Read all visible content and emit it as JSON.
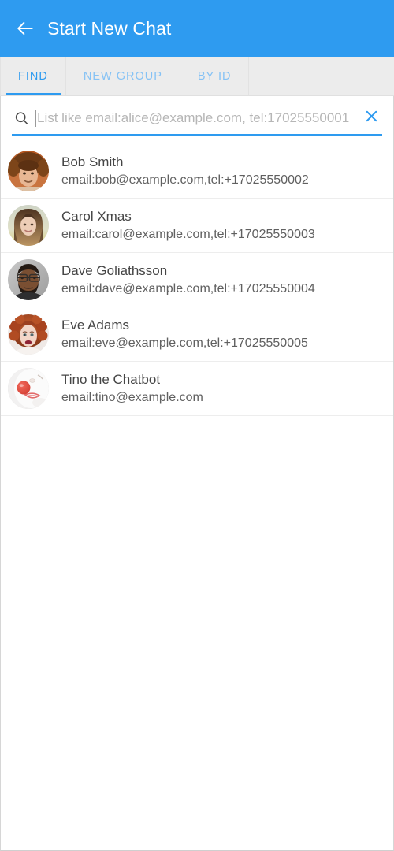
{
  "theme": {
    "accent": "#2e9bf0",
    "accent_muted": "#85c2f5",
    "appbar_bg": "#2e9bf0",
    "tabbar_bg": "#ececec",
    "page_bg": "#ffffff",
    "name_color": "#454545",
    "detail_color": "#606060",
    "placeholder_color": "#b6b6b6"
  },
  "appbar": {
    "back_icon": "arrow-left-icon",
    "title": "Start New Chat"
  },
  "tabs": [
    {
      "label": "FIND",
      "active": true
    },
    {
      "label": "NEW GROUP",
      "active": false
    },
    {
      "label": "BY ID",
      "active": false
    }
  ],
  "search": {
    "icon": "search-icon",
    "value": "",
    "placeholder": "List like email:alice@example.com, tel:17025550001",
    "clear_icon": "close-icon",
    "focused": true
  },
  "contacts": [
    {
      "name": "Bob Smith",
      "detail": "email:bob@example.com,tel:+17025550002",
      "avatar": "photo-man-fur-hat"
    },
    {
      "name": "Carol Xmas",
      "detail": "email:carol@example.com,tel:+17025550003",
      "avatar": "photo-woman-long-hair"
    },
    {
      "name": "Dave Goliathsson",
      "detail": "email:dave@example.com,tel:+17025550004",
      "avatar": "photo-man-glasses-beard"
    },
    {
      "name": "Eve Adams",
      "detail": "email:eve@example.com,tel:+17025550005",
      "avatar": "photo-woman-red-curly-hair"
    },
    {
      "name": "Tino the Chatbot",
      "detail": "email:tino@example.com",
      "avatar": "photo-clown-red-nose"
    }
  ]
}
